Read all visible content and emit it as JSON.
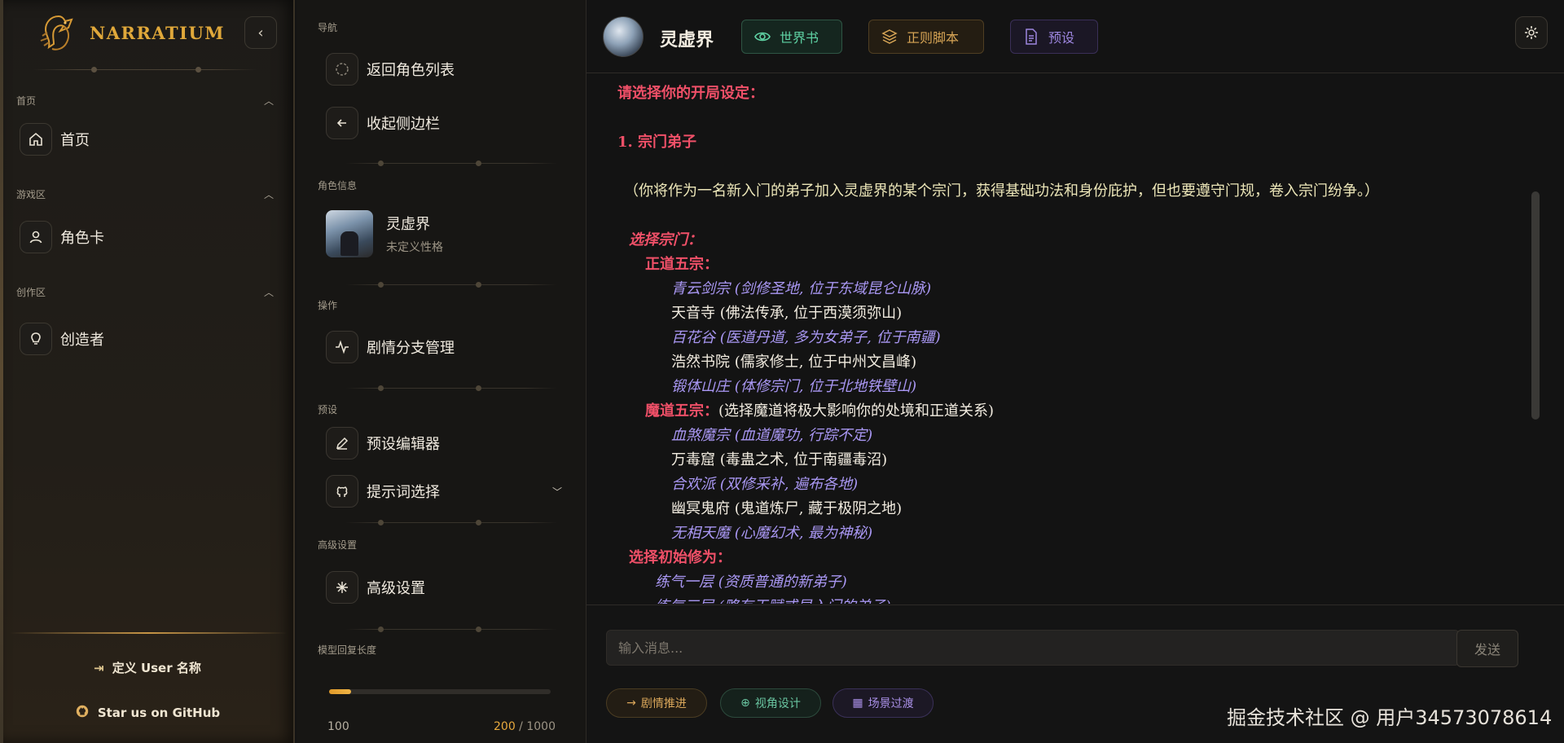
{
  "sidebar": {
    "brand": "Narratium",
    "sections": [
      {
        "title": "首页",
        "items": [
          {
            "label": "首页",
            "icon": "home-icon"
          }
        ]
      },
      {
        "title": "游戏区",
        "items": [
          {
            "label": "角色卡",
            "icon": "user-icon"
          }
        ]
      },
      {
        "title": "创作区",
        "items": [
          {
            "label": "创造者",
            "icon": "lightbulb-icon"
          }
        ]
      }
    ],
    "bottom": {
      "username_label": "定义 User 名称",
      "github_label": "Star us on GitHub"
    }
  },
  "panel": {
    "nav_title": "导航",
    "back_label": "返回角色列表",
    "collapse_label": "收起侧边栏",
    "char_info_title": "角色信息",
    "character": {
      "name": "灵虚界",
      "personality": "未定义性格"
    },
    "ops_title": "操作",
    "branch_label": "剧情分支管理",
    "preset_title": "预设",
    "preset_editor_label": "预设编辑器",
    "prompt_select_label": "提示词选择",
    "advanced_title": "高级设置",
    "advanced_label": "高级设置",
    "length_title": "模型回复长度",
    "length": {
      "min": "100",
      "value": "200",
      "sep": " / ",
      "max": "1000",
      "fraction": 0.1
    }
  },
  "header": {
    "title": "灵虚界",
    "buttons": {
      "world_book": "世界书",
      "regex": "正则脚本",
      "preset": "预设"
    }
  },
  "chat": {
    "lines": [
      {
        "text": "请选择你的开局设定：",
        "style": "red"
      },
      {
        "text": "1. 宗门弟子",
        "style": "red"
      },
      {
        "text": "（你将作为一名新入门的弟子加入灵虚界的某个宗门，获得基础功法和身份庇护，但也要遵守门规，卷入宗门纷争。）",
        "style": "beige"
      },
      {
        "text": "选择宗门：",
        "style": "red-italic"
      },
      {
        "text": "正道五宗：",
        "style": "red"
      },
      {
        "text": "青云剑宗 (剑修圣地, 位于东域昆仑山脉)",
        "style": "purple"
      },
      {
        "text": "天音寺 (佛法传承, 位于西漠须弥山)",
        "style": "plain"
      },
      {
        "text": "百花谷 (医道丹道, 多为女弟子, 位于南疆)",
        "style": "purple"
      },
      {
        "text": "浩然书院 (儒家修士, 位于中州文昌峰)",
        "style": "plain"
      },
      {
        "text": "锻体山庄 (体修宗门, 位于北地铁壁山)",
        "style": "purple"
      },
      {
        "text": "魔道五宗：",
        "style": "red",
        "suffix": "(选择魔道将极大影响你的处境和正道关系)"
      },
      {
        "text": "血煞魔宗 (血道魔功, 行踪不定)",
        "style": "purple"
      },
      {
        "text": "万毒窟 (毒蛊之术, 位于南疆毒沼)",
        "style": "plain"
      },
      {
        "text": "合欢派 (双修采补, 遍布各地)",
        "style": "purple"
      },
      {
        "text": "幽冥鬼府 (鬼道炼尸, 藏于极阴之地)",
        "style": "plain"
      },
      {
        "text": "无相天魔 (心魔幻术, 最为神秘)",
        "style": "purple"
      },
      {
        "text": "选择初始修为：",
        "style": "red"
      },
      {
        "text": "练气一层 (资质普通的新弟子)",
        "style": "purple"
      },
      {
        "text": "练气三层 (略有天赋或早入门的弟子)",
        "style": "purple"
      }
    ]
  },
  "composer": {
    "placeholder": "输入消息...",
    "send_label": "发送",
    "chips": [
      "剧情推进",
      "视角设计",
      "场景过渡"
    ]
  },
  "watermark": "掘金技术社区 @ 用户34573078614",
  "colors": {
    "accent_gold": "#e0a83a",
    "accent_green": "#5fd3a4",
    "accent_purple": "#9d86df",
    "text_red": "#f05068"
  }
}
